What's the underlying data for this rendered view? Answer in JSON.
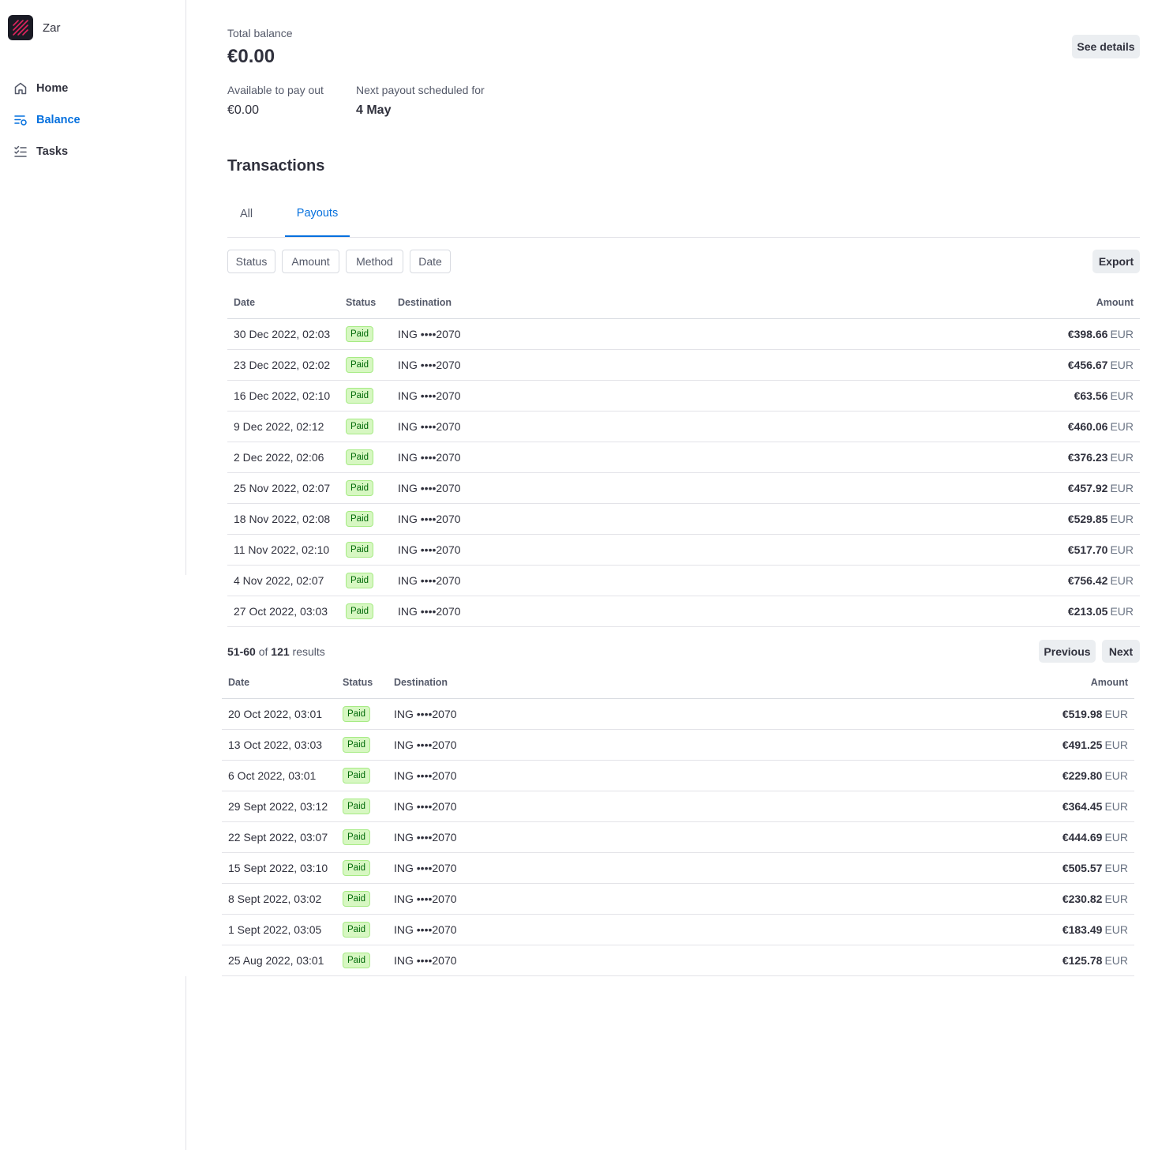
{
  "app": {
    "account_name": "Zar"
  },
  "sidebar": {
    "items": [
      {
        "label": "Home",
        "icon": "home-icon",
        "active": false
      },
      {
        "label": "Balance",
        "icon": "balance-icon",
        "active": true
      },
      {
        "label": "Tasks",
        "icon": "tasks-icon",
        "active": false
      }
    ]
  },
  "balance": {
    "total_label": "Total balance",
    "total_value": "€0.00",
    "see_details_label": "See details",
    "available_label": "Available to pay out",
    "available_value": "€0.00",
    "next_payout_label": "Next payout scheduled for",
    "next_payout_value": "4 May"
  },
  "transactions": {
    "title": "Transactions",
    "tabs": [
      {
        "label": "All",
        "active": false
      },
      {
        "label": "Payouts",
        "active": true
      }
    ],
    "filters": [
      "Status",
      "Amount",
      "Method",
      "Date"
    ],
    "export_label": "Export",
    "columns": {
      "date": "Date",
      "status": "Status",
      "destination": "Destination",
      "amount": "Amount"
    },
    "rows": [
      {
        "date": "30 Dec 2022, 02:03",
        "status": "Paid",
        "destination": "ING ••••2070",
        "amount": "€398.66",
        "currency": "EUR"
      },
      {
        "date": "23 Dec 2022, 02:02",
        "status": "Paid",
        "destination": "ING ••••2070",
        "amount": "€456.67",
        "currency": "EUR"
      },
      {
        "date": "16 Dec 2022, 02:10",
        "status": "Paid",
        "destination": "ING ••••2070",
        "amount": "€63.56",
        "currency": "EUR"
      },
      {
        "date": "9 Dec 2022, 02:12",
        "status": "Paid",
        "destination": "ING ••••2070",
        "amount": "€460.06",
        "currency": "EUR"
      },
      {
        "date": "2 Dec 2022, 02:06",
        "status": "Paid",
        "destination": "ING ••••2070",
        "amount": "€376.23",
        "currency": "EUR"
      },
      {
        "date": "25 Nov 2022, 02:07",
        "status": "Paid",
        "destination": "ING ••••2070",
        "amount": "€457.92",
        "currency": "EUR"
      },
      {
        "date": "18 Nov 2022, 02:08",
        "status": "Paid",
        "destination": "ING ••••2070",
        "amount": "€529.85",
        "currency": "EUR"
      },
      {
        "date": "11 Nov 2022, 02:10",
        "status": "Paid",
        "destination": "ING ••••2070",
        "amount": "€517.70",
        "currency": "EUR"
      },
      {
        "date": "4 Nov 2022, 02:07",
        "status": "Paid",
        "destination": "ING ••••2070",
        "amount": "€756.42",
        "currency": "EUR"
      },
      {
        "date": "27 Oct 2022, 03:03",
        "status": "Paid",
        "destination": "ING ••••2070",
        "amount": "€213.05",
        "currency": "EUR"
      }
    ],
    "pagination": {
      "range": "51-60",
      "of_text": "of",
      "total": "121",
      "results_text": "results",
      "previous_label": "Previous",
      "next_label": "Next"
    },
    "rows_next": [
      {
        "date": "20 Oct 2022, 03:01",
        "status": "Paid",
        "destination": "ING ••••2070",
        "amount": "€519.98",
        "currency": "EUR"
      },
      {
        "date": "13 Oct 2022, 03:03",
        "status": "Paid",
        "destination": "ING ••••2070",
        "amount": "€491.25",
        "currency": "EUR"
      },
      {
        "date": "6 Oct 2022, 03:01",
        "status": "Paid",
        "destination": "ING ••••2070",
        "amount": "€229.80",
        "currency": "EUR"
      },
      {
        "date": "29 Sept 2022, 03:12",
        "status": "Paid",
        "destination": "ING ••••2070",
        "amount": "€364.45",
        "currency": "EUR"
      },
      {
        "date": "22 Sept 2022, 03:07",
        "status": "Paid",
        "destination": "ING ••••2070",
        "amount": "€444.69",
        "currency": "EUR"
      },
      {
        "date": "15 Sept 2022, 03:10",
        "status": "Paid",
        "destination": "ING ••••2070",
        "amount": "€505.57",
        "currency": "EUR"
      },
      {
        "date": "8 Sept 2022, 03:02",
        "status": "Paid",
        "destination": "ING ••••2070",
        "amount": "€230.82",
        "currency": "EUR"
      },
      {
        "date": "1 Sept 2022, 03:05",
        "status": "Paid",
        "destination": "ING ••••2070",
        "amount": "€183.49",
        "currency": "EUR"
      },
      {
        "date": "25 Aug 2022, 03:01",
        "status": "Paid",
        "destination": "ING ••••2070",
        "amount": "€125.78",
        "currency": "EUR"
      }
    ]
  },
  "colors": {
    "accent": "#0570de",
    "text": "#30313d",
    "paid_badge_bg": "#d7f7c2",
    "paid_badge_text": "#006908",
    "logo_bg": "#1a1b25",
    "logo_stripes": "#e0245e"
  }
}
